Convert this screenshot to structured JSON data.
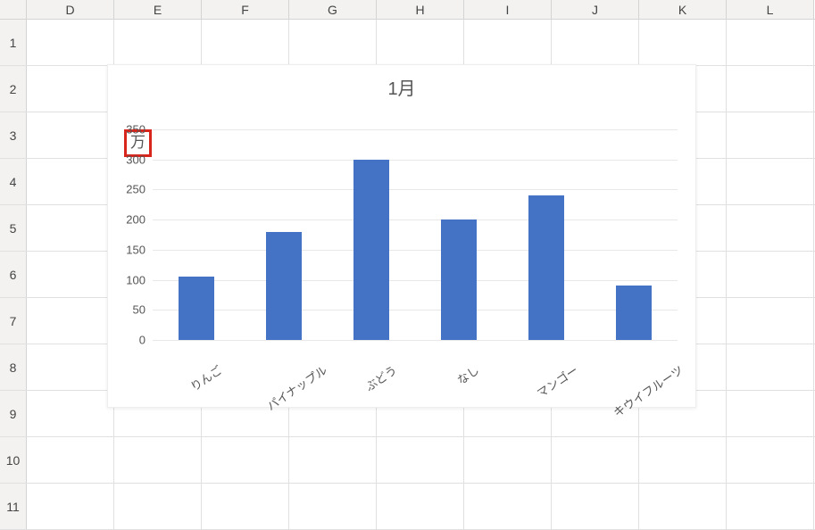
{
  "spreadsheet": {
    "column_headers": [
      "D",
      "E",
      "F",
      "G",
      "H",
      "I",
      "J",
      "K",
      "L"
    ],
    "row_headers": [
      "1",
      "2",
      "3",
      "4",
      "5",
      "6",
      "7",
      "8",
      "9",
      "10",
      "11"
    ]
  },
  "highlight": {
    "unit_label": "万"
  },
  "chart_data": {
    "type": "bar",
    "title": "1月",
    "categories": [
      "りんご",
      "パイナップル",
      "ぶどう",
      "なし",
      "マンゴー",
      "キウイフルーツ"
    ],
    "values": [
      105,
      180,
      300,
      200,
      240,
      90
    ],
    "ylabel_unit": "万",
    "ylim": [
      0,
      350
    ],
    "y_ticks": [
      0,
      50,
      100,
      150,
      200,
      250,
      300,
      350
    ],
    "bar_color": "#4472c4"
  }
}
